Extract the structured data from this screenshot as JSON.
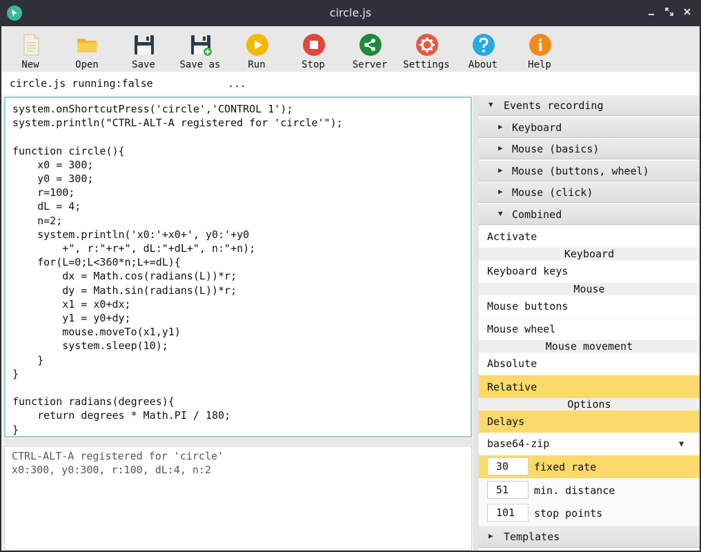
{
  "window": {
    "title": "circle.js"
  },
  "toolbar": {
    "new": "New",
    "open": "Open",
    "save": "Save",
    "save_as": "Save as",
    "run": "Run",
    "stop": "Stop",
    "server": "Server",
    "settings": "Settings",
    "about": "About",
    "help": "Help"
  },
  "status": {
    "text": "circle.js running:false",
    "dots": "..."
  },
  "editor": {
    "code": "system.onShortcutPress('circle','CONTROL 1');\nsystem.println(\"CTRL-ALT-A registered for 'circle'\");\n\nfunction circle(){\n    x0 = 300;\n    y0 = 300;\n    r=100;\n    dL = 4;\n    n=2;\n    system.println('x0:'+x0+', y0:'+y0\n        +\", r:\"+r+\", dL:\"+dL+\", n:\"+n);\n    for(L=0;L<360*n;L+=dL){\n        dx = Math.cos(radians(L))*r;\n        dy = Math.sin(radians(L))*r;\n        x1 = x0+dx;\n        y1 = y0+dy;\n        mouse.moveTo(x1,y1)\n        system.sleep(10);\n    }\n}\n\nfunction radians(degrees){\n    return degrees * Math.PI / 180;\n}"
  },
  "console": {
    "output": "CTRL-ALT-A registered for 'circle'\nx0:300, y0:300, r:100, dL:4, n:2"
  },
  "panel": {
    "events_recording": "Events recording",
    "keyboard": "Keyboard",
    "mouse_basics": "Mouse (basics)",
    "mouse_buttons_wheel": "Mouse (buttons, wheel)",
    "mouse_click": "Mouse (click)",
    "combined": "Combined",
    "activate": "Activate",
    "hdr_keyboard": "Keyboard",
    "keyboard_keys": "Keyboard keys",
    "hdr_mouse": "Mouse",
    "mouse_buttons": "Mouse buttons",
    "mouse_wheel": "Mouse wheel",
    "hdr_mouse_movement": "Mouse movement",
    "absolute": "Absolute",
    "relative": "Relative",
    "hdr_options": "Options",
    "delays": "Delays",
    "encoding_value": "base64-zip",
    "fixed_rate_value": "30",
    "fixed_rate_label": "fixed rate",
    "min_distance_value": "51",
    "min_distance_label": "min. distance",
    "stop_points_value": "101",
    "stop_points_label": "stop points",
    "templates": "Templates"
  },
  "colors": {
    "highlight": "#fbd96b",
    "editor_border": "#9ccfd0"
  }
}
